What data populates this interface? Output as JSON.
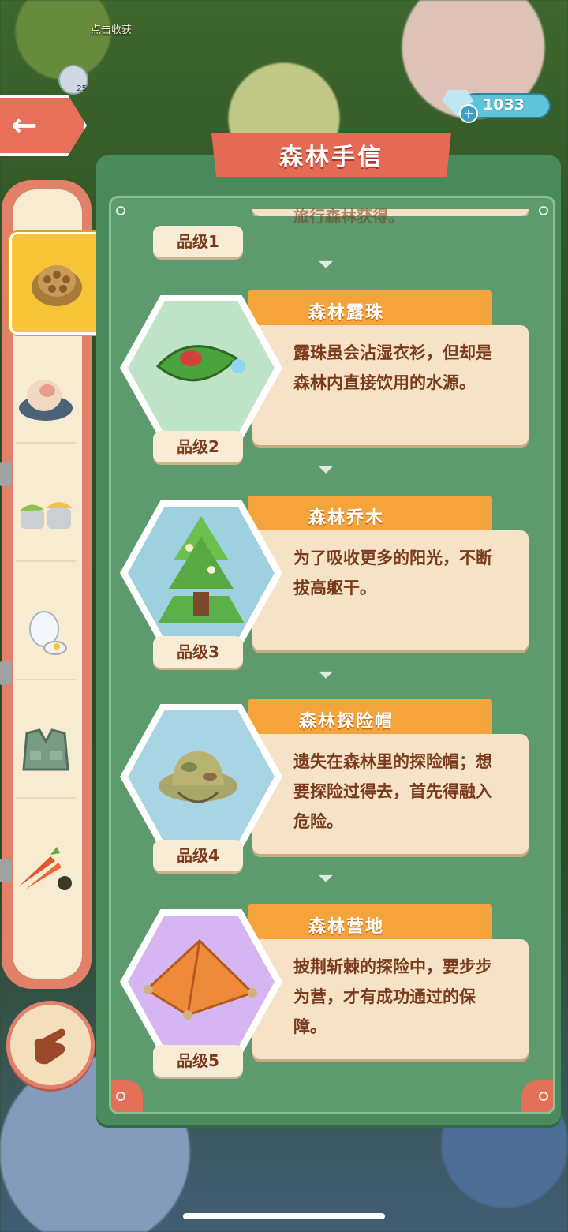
{
  "background": {
    "hint_text": "点击收获",
    "badge_value": "25"
  },
  "header": {
    "title": "森林手信",
    "gems": "1033"
  },
  "tabs": [
    {
      "icon": "pinecone-icon",
      "active": true
    },
    {
      "icon": "rock-icon",
      "active": false
    },
    {
      "icon": "moss-stone-icon",
      "active": false
    },
    {
      "icon": "feather-egg-icon",
      "active": false
    },
    {
      "icon": "vest-icon",
      "active": false
    },
    {
      "icon": "carrot-icon",
      "active": false
    }
  ],
  "entries": [
    {
      "grade": "品级1",
      "name": "",
      "desc": "旅行森林获得。",
      "bg": "#f4e3cb"
    },
    {
      "grade": "品级2",
      "name": "森林露珠",
      "desc": "露珠虽会沾湿衣衫，但却是森林内直接饮用的水源。",
      "bg": "#bfe3c7",
      "icon": "leaf-dewdrop-icon"
    },
    {
      "grade": "品级3",
      "name": "森林乔木",
      "desc": "为了吸收更多的阳光，不断拔高躯干。",
      "bg": "#9fd0e0",
      "icon": "tree-icon"
    },
    {
      "grade": "品级4",
      "name": "森林探险帽",
      "desc": "遗失在森林里的探险帽；想要探险过得去，首先得融入危险。",
      "bg": "#a9d4e3",
      "icon": "explorer-hat-icon"
    },
    {
      "grade": "品级5",
      "name": "森林营地",
      "desc": "披荆斩棘的探险中，要步步为营，才有成功通过的保障。",
      "bg": "#d6b6f2",
      "icon": "tent-icon"
    }
  ]
}
